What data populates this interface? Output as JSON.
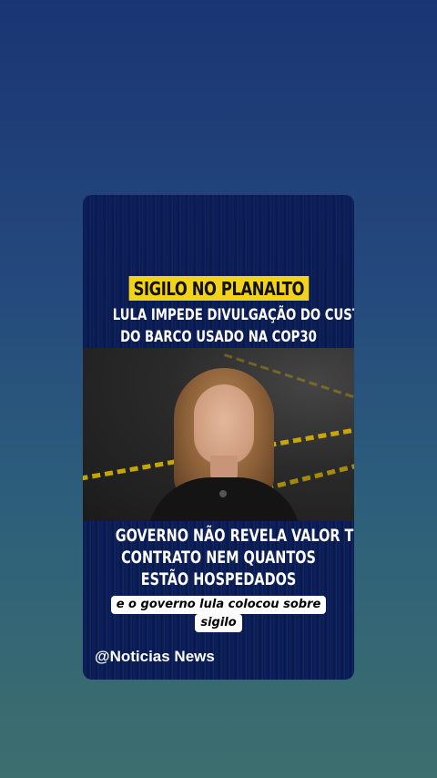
{
  "post": {
    "banner": "SIGILO NO PLANALTO",
    "headline_lines": [
      "LULA IMPEDE DIVULGAÇÃO DO CUSTO",
      "DO BARCO USADO NA COP30"
    ],
    "caption_lines": [
      "GOVERNO NÃO REVELA VALOR TOTAL",
      "CONTRATO NEM QUANTOS",
      "ESTÃO HOSPEDADOS"
    ],
    "subtitle_lines": [
      "e o governo lula colocou sobre",
      "sigilo"
    ],
    "handle": "@Noticias News"
  },
  "colors": {
    "banner_bg": "#f2d31a",
    "card_bg": "#0d2260",
    "page_gradient_top": "#1a3573",
    "page_gradient_bottom": "#3d6f6e"
  }
}
